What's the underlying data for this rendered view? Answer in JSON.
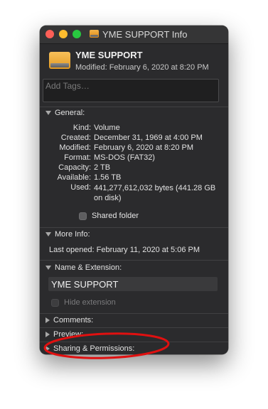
{
  "window": {
    "title": "YME SUPPORT Info",
    "title_icon": "drive-icon"
  },
  "header": {
    "name": "YME SUPPORT",
    "modified": "Modified: February 6, 2020 at 8:20 PM",
    "icon": "external-drive-icon"
  },
  "tags": {
    "placeholder": "Add Tags…",
    "value": ""
  },
  "general": {
    "label": "General:",
    "expanded": true,
    "rows": [
      {
        "label": "Kind:",
        "value": "Volume"
      },
      {
        "label": "Created:",
        "value": "December 31, 1969 at 4:00 PM"
      },
      {
        "label": "Modified:",
        "value": "February 6, 2020 at 8:20 PM"
      },
      {
        "label": "Format:",
        "value": "MS-DOS (FAT32)"
      },
      {
        "label": "Capacity:",
        "value": "2 TB"
      },
      {
        "label": "Available:",
        "value": "1.56 TB"
      },
      {
        "label": "Used:",
        "value": "441,277,612,032 bytes (441.28 GB on disk)"
      }
    ],
    "shared_folder": {
      "label": "Shared folder",
      "checked": false
    }
  },
  "more_info": {
    "label": "More Info:",
    "expanded": true,
    "last_opened": "Last opened: February 11, 2020 at 5:06 PM"
  },
  "name_extension": {
    "label": "Name & Extension:",
    "expanded": true,
    "name_value": "YME SUPPORT",
    "hide_extension": {
      "label": "Hide extension",
      "checked": false,
      "enabled": false
    }
  },
  "comments": {
    "label": "Comments:",
    "expanded": false
  },
  "preview": {
    "label": "Preview:",
    "expanded": false
  },
  "sharing": {
    "label": "Sharing & Permissions:",
    "expanded": false
  },
  "colors": {
    "window_bg": "#2b2b2d",
    "close": "#ff5f57",
    "minimize": "#febc2e",
    "zoom": "#28c840",
    "annotation": "#e01010"
  }
}
